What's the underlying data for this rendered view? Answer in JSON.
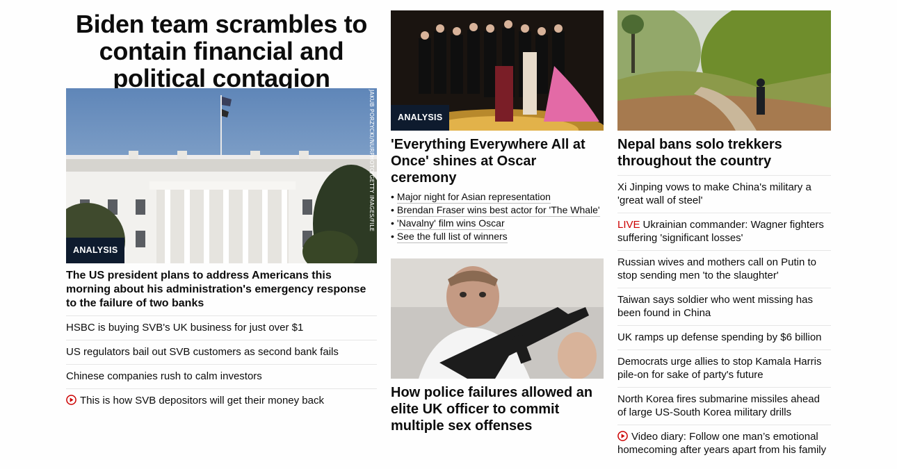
{
  "left": {
    "headline": "Biden team scrambles to contain financial and political contagion",
    "badge": "ANALYSIS",
    "photo_credit": "JAKUB PORZYCKI/NURPHOTO/GETTY IMAGES/FILE",
    "sub_headline": "The US president plans to address Americans this morning about his administration's emergency response to the failure of two banks",
    "links": [
      "HSBC is buying SVB's UK business for just over $1",
      "US regulators bail out SVB customers as second bank fails",
      "Chinese companies rush to calm investors",
      "This is how SVB depositors will get their money back"
    ]
  },
  "middle": {
    "oscar": {
      "badge": "ANALYSIS",
      "title": "'Everything Everywhere All at Once' shines at Oscar ceremony",
      "bullets": [
        "Major night for Asian representation",
        "Brendan Fraser wins best actor for 'The Whale'",
        "'Navalny' film wins Oscar",
        "See the full list of winners"
      ]
    },
    "police": {
      "title": "How police failures allowed an elite UK officer to commit multiple sex offenses"
    }
  },
  "right": {
    "nepal_title": "Nepal bans solo trekkers throughout the country",
    "links": [
      {
        "label": "",
        "text": "Xi Jinping vows to make China's military a 'great wall of steel'"
      },
      {
        "label": "LIVE",
        "text": "Ukrainian commander: Wagner fighters suffering 'significant losses'"
      },
      {
        "label": "",
        "text": "Russian wives and mothers call on Putin to stop sending men 'to the slaughter'"
      },
      {
        "label": "",
        "text": "Taiwan says soldier who went missing has been found in China"
      },
      {
        "label": "",
        "text": "UK ramps up defense spending by $6 billion"
      },
      {
        "label": "",
        "text": "Democrats urge allies to stop Kamala Harris pile-on for sake of party's future"
      },
      {
        "label": "",
        "text": "North Korea fires submarine missiles ahead of large US-South Korea military drills"
      },
      {
        "label": "",
        "text": "Video diary: Follow one man’s emotional homecoming after years apart from his family"
      }
    ]
  },
  "icons": {
    "video": "play-circle-icon"
  },
  "colors": {
    "live": "#cc0000",
    "badge_bg": "#0e1b2e",
    "divider": "#e6e6e6"
  }
}
